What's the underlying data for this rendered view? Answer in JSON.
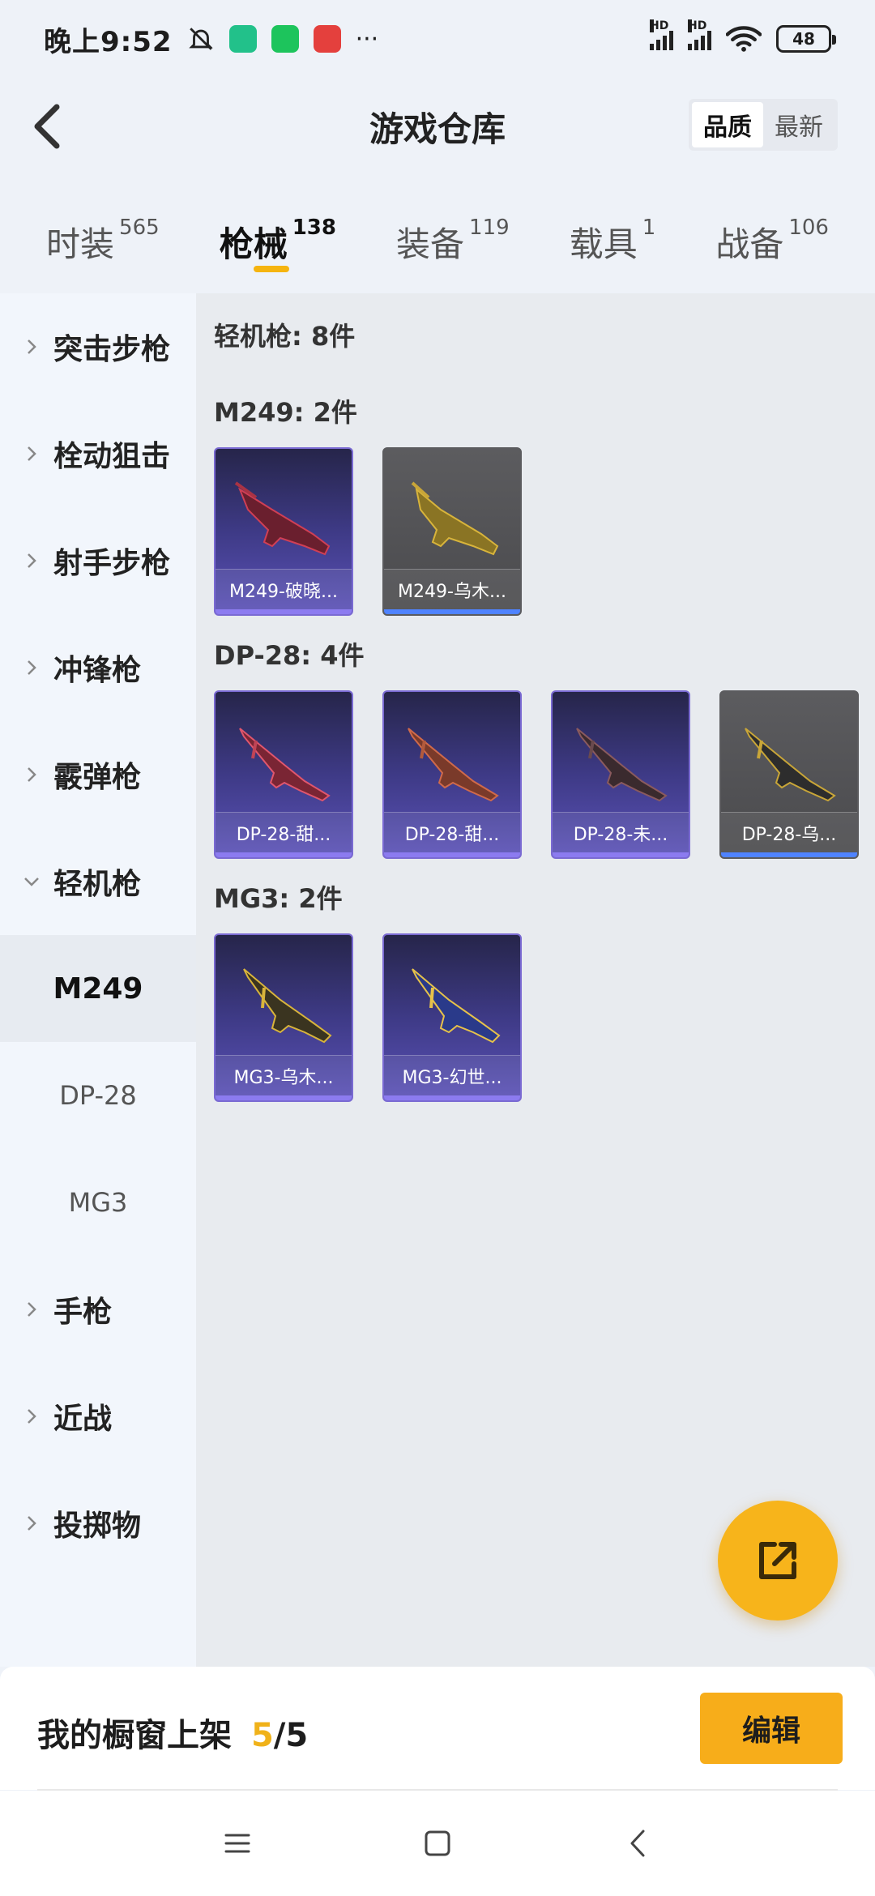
{
  "status_bar": {
    "time": "晚上9:52",
    "signal_1": "HD",
    "signal_2": "HD",
    "battery": "48",
    "more": "···"
  },
  "header": {
    "title": "游戏仓库",
    "sort_options": [
      "品质",
      "最新"
    ]
  },
  "tabs": [
    {
      "label": "时装",
      "count": "565"
    },
    {
      "label": "枪械",
      "count": "138"
    },
    {
      "label": "装备",
      "count": "119"
    },
    {
      "label": "载具",
      "count": "1"
    },
    {
      "label": "战备",
      "count": "106"
    }
  ],
  "sidebar": {
    "items": [
      {
        "label": "突击步枪"
      },
      {
        "label": "栓动狙击"
      },
      {
        "label": "射手步枪"
      },
      {
        "label": "冲锋枪"
      },
      {
        "label": "霰弹枪"
      },
      {
        "label": "轻机枪"
      },
      {
        "label": "手枪"
      },
      {
        "label": "近战"
      },
      {
        "label": "投掷物"
      }
    ],
    "subitems": [
      "M249",
      "DP-28",
      "MG3"
    ]
  },
  "content": {
    "group_title": "轻机枪: 8件",
    "sections": [
      {
        "title": "M249: 2件",
        "items": [
          "M249-破晓...",
          "M249-乌木..."
        ]
      },
      {
        "title": "DP-28: 4件",
        "items": [
          "DP-28-甜...",
          "DP-28-甜...",
          "DP-28-未...",
          "DP-28-乌..."
        ]
      },
      {
        "title": "MG3: 2件",
        "items": [
          "MG3-乌木...",
          "MG3-幻世..."
        ]
      }
    ]
  },
  "bottom": {
    "showcase_label": "我的橱窗上架",
    "showcase_current": "5",
    "showcase_total": "/5",
    "edit_label": "编辑"
  },
  "colors": {
    "accent": "#f7b41b",
    "tab_underline": "#f5b40f",
    "card_purple": "#3e3a86",
    "card_gray": "#5c5c5f"
  }
}
